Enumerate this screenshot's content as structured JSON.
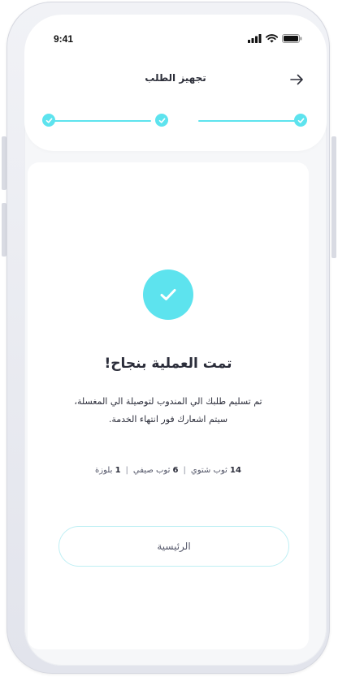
{
  "status_bar": {
    "time": "9:41"
  },
  "header": {
    "title": "تجهيز الطلب",
    "back_icon": "arrow-right-icon"
  },
  "stepper": {
    "steps_completed": 3,
    "steps_total": 3
  },
  "success": {
    "icon": "check-circle-icon",
    "title": "تمت العملية بنجاح!",
    "message_line1": "تم تسليم طلبك الي المندوب لتوصيلة الي المغسلة،",
    "message_line2": "سيتم اشعارك فور انتهاء الخدمة."
  },
  "items": [
    {
      "count": "14",
      "label": "ثوب شتوي"
    },
    {
      "count": "6",
      "label": "ثوب صيفي"
    },
    {
      "count": "1",
      "label": "بلوزة"
    }
  ],
  "actions": {
    "home_label": "الرئيسية"
  },
  "colors": {
    "accent": "#5de3ee",
    "text": "#2b2d3a",
    "muted": "#55586a",
    "button_border": "#bfeff4"
  }
}
